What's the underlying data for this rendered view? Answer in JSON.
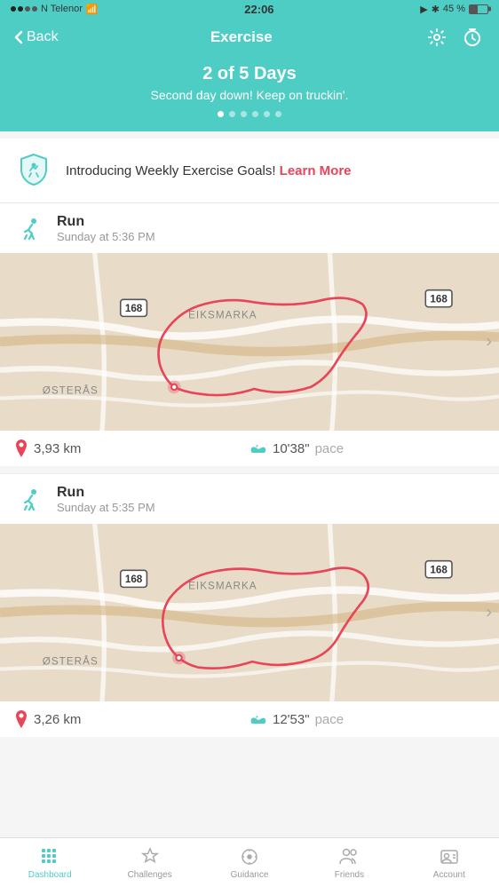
{
  "statusBar": {
    "carrier": "N Telenor",
    "wifi": true,
    "time": "22:06",
    "location": true,
    "bluetooth": true,
    "battery": "45 %"
  },
  "navBar": {
    "backLabel": "Back",
    "title": "Exercise",
    "settingsIcon": "gear-icon",
    "timerIcon": "stopwatch-icon"
  },
  "heroBanner": {
    "title": "2 of 5 Days",
    "subtitle": "Second day down! Keep on truckin'.",
    "dots": [
      {
        "active": true
      },
      {
        "active": false
      },
      {
        "active": false
      },
      {
        "active": false
      },
      {
        "active": false
      },
      {
        "active": false
      }
    ]
  },
  "goalsBanner": {
    "text": "Introducing Weekly Exercise Goals!",
    "linkText": "Learn More"
  },
  "exercises": [
    {
      "type": "Run",
      "datetime": "Sunday at 5:36 PM",
      "distance": "3,93 km",
      "pace": "10'38\"",
      "paceLabel": "pace",
      "roadSignLeft": "168",
      "roadSignRight": "168",
      "areaLabel": "EIKSMARKA",
      "areaLabel2": "ØSTERÅS"
    },
    {
      "type": "Run",
      "datetime": "Sunday at 5:35 PM",
      "distance": "3,26 km",
      "pace": "12'53\"",
      "paceLabel": "pace",
      "roadSignLeft": "168",
      "roadSignRight": "168",
      "areaLabel": "EIKSMARKA",
      "areaLabel2": "ØSTERÅS"
    }
  ],
  "bottomNav": {
    "items": [
      {
        "label": "Dashboard",
        "icon": "grid-icon",
        "active": true
      },
      {
        "label": "Challenges",
        "icon": "star-icon",
        "active": false
      },
      {
        "label": "Guidance",
        "icon": "compass-icon",
        "active": false
      },
      {
        "label": "Friends",
        "icon": "friends-icon",
        "active": false
      },
      {
        "label": "Account",
        "icon": "account-icon",
        "active": false
      }
    ]
  }
}
